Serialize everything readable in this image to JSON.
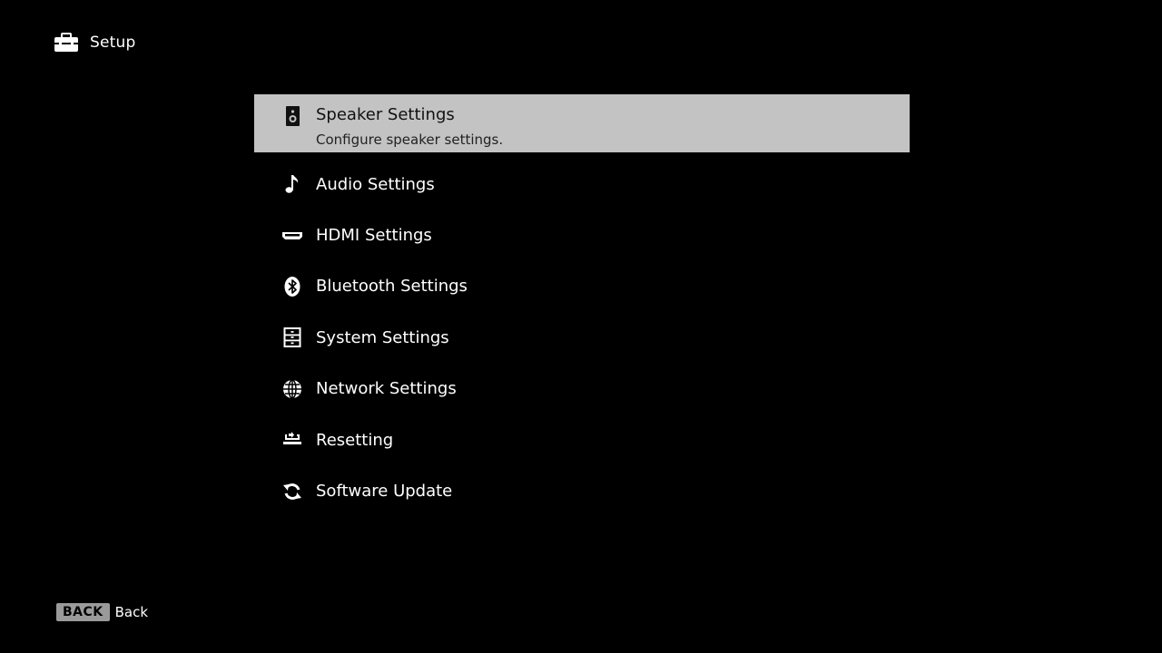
{
  "header": {
    "title": "Setup",
    "icon": "toolbox-icon"
  },
  "menu": {
    "selected_index": 0,
    "items": [
      {
        "label": "Speaker Settings",
        "description": "Configure speaker settings.",
        "icon": "speaker-icon"
      },
      {
        "label": "Audio Settings",
        "icon": "music-note-icon"
      },
      {
        "label": "HDMI Settings",
        "icon": "hdmi-icon"
      },
      {
        "label": "Bluetooth Settings",
        "icon": "bluetooth-icon"
      },
      {
        "label": "System Settings",
        "icon": "system-icon"
      },
      {
        "label": "Network Settings",
        "icon": "globe-icon"
      },
      {
        "label": "Resetting",
        "icon": "reset-icon"
      },
      {
        "label": "Software Update",
        "icon": "update-icon"
      }
    ]
  },
  "footer": {
    "key": "BACK",
    "label": "Back"
  },
  "colors": {
    "background": "#000000",
    "selected_bg": "#c3c3c3",
    "text": "#ffffff",
    "selected_text": "#111111",
    "key_bg": "#9a9a9a"
  }
}
